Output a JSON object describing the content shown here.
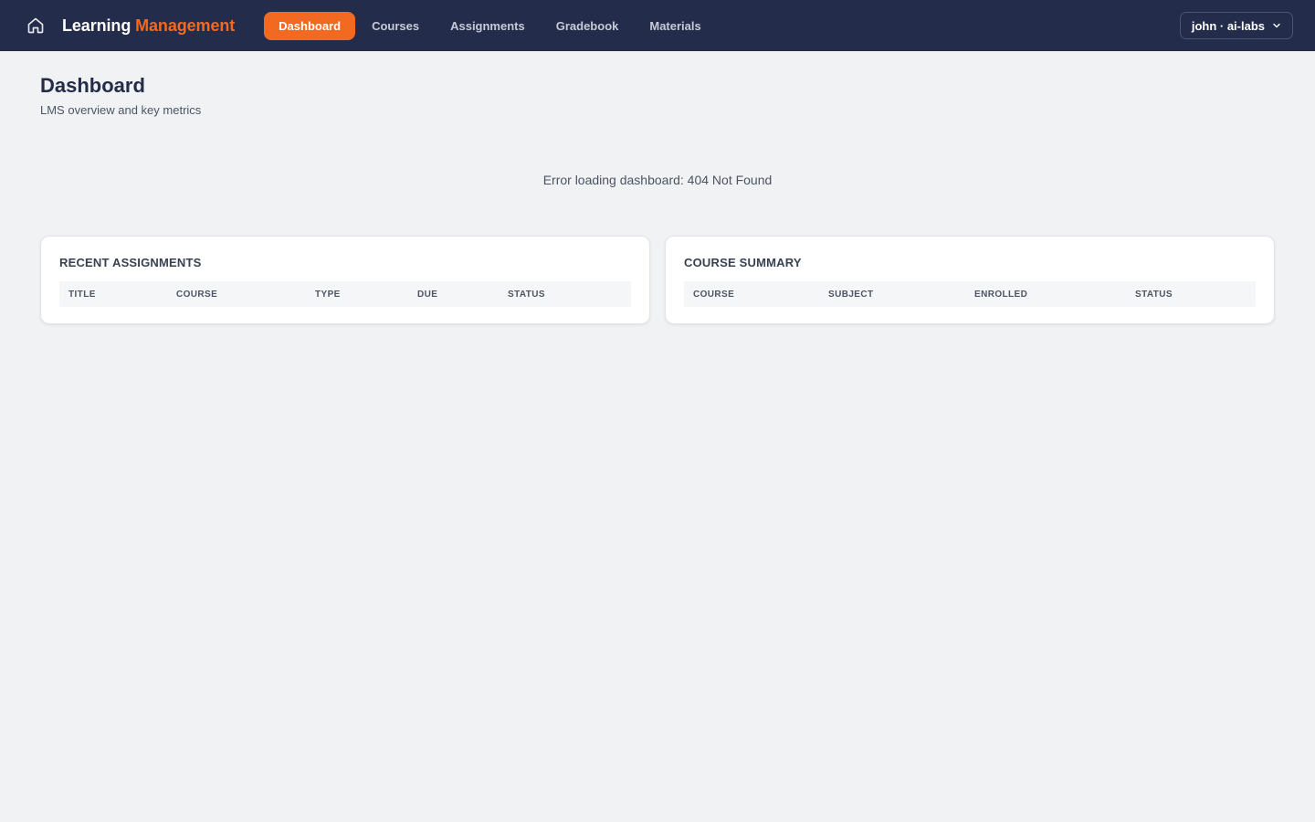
{
  "header": {
    "brand_main": "Learning",
    "brand_accent": "Management",
    "nav": [
      {
        "label": "Dashboard",
        "active": true
      },
      {
        "label": "Courses",
        "active": false
      },
      {
        "label": "Assignments",
        "active": false
      },
      {
        "label": "Gradebook",
        "active": false
      },
      {
        "label": "Materials",
        "active": false
      }
    ],
    "user_label": "john · ai-labs",
    "icons": {
      "home": "home-icon",
      "user_menu": "chevron-down-icon"
    }
  },
  "page": {
    "title": "Dashboard",
    "subtitle": "LMS overview and key metrics",
    "error": "Error loading dashboard: 404 Not Found"
  },
  "cards": {
    "recent_assignments": {
      "title": "RECENT ASSIGNMENTS",
      "columns": [
        "TITLE",
        "COURSE",
        "TYPE",
        "DUE",
        "STATUS"
      ],
      "rows": []
    },
    "course_summary": {
      "title": "COURSE SUMMARY",
      "columns": [
        "COURSE",
        "SUBJECT",
        "ENROLLED",
        "STATUS"
      ],
      "rows": []
    }
  },
  "colors": {
    "topbar": "#232c4a",
    "accent": "#f26a21",
    "background": "#f1f2f4"
  }
}
